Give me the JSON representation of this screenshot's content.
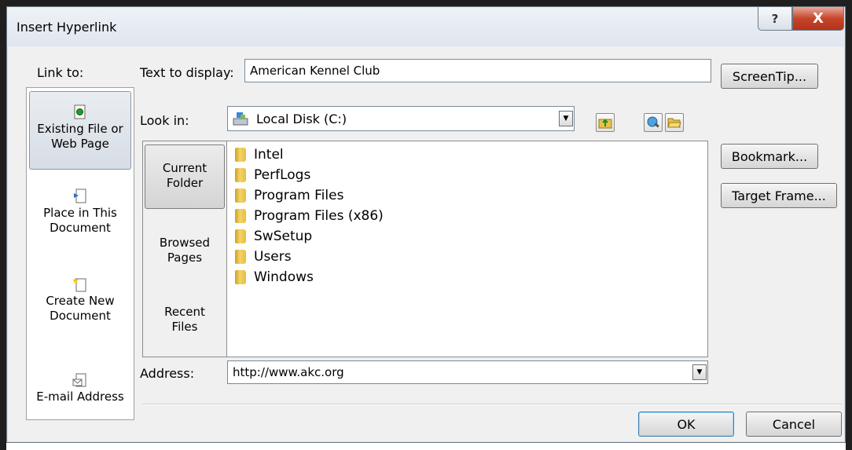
{
  "window": {
    "title": "Insert Hyperlink",
    "help_glyph": "?",
    "close_glyph": "X"
  },
  "link_to": {
    "label": "Link to:",
    "items": [
      {
        "label_line1": "Existing File or",
        "label_line2": "Web Page",
        "icon": "web-page-icon",
        "selected": true
      },
      {
        "label_line1": "Place in This",
        "label_line2": "Document",
        "icon": "place-document-icon",
        "selected": false
      },
      {
        "label_line1": "Create New",
        "label_line2": "Document",
        "icon": "new-document-icon",
        "selected": false
      },
      {
        "label_line1": "E-mail Address",
        "label_line2": "",
        "icon": "email-icon",
        "selected": false
      }
    ]
  },
  "text_to_display": {
    "label": "Text to display:",
    "value": "American Kennel Club"
  },
  "look_in": {
    "label": "Look in:",
    "value": "Local Disk (C:)"
  },
  "view_bar": {
    "items": [
      {
        "label_line1": "Current",
        "label_line2": "Folder",
        "selected": true
      },
      {
        "label_line1": "Browsed",
        "label_line2": "Pages",
        "selected": false
      },
      {
        "label_line1": "Recent",
        "label_line2": "Files",
        "selected": false
      }
    ]
  },
  "files": [
    "Intel",
    "PerfLogs",
    "Program Files",
    "Program Files (x86)",
    "SwSetup",
    "Users",
    "Windows"
  ],
  "address": {
    "label": "Address:",
    "value": "http://www.akc.org"
  },
  "buttons": {
    "screentip": "ScreenTip...",
    "bookmark": "Bookmark...",
    "target_frame": "Target Frame...",
    "ok": "OK",
    "cancel": "Cancel"
  },
  "colors": {
    "dialog_bg": "#f0f0f0",
    "close_button": "#c5462b",
    "folder": "#e7bf3a"
  }
}
